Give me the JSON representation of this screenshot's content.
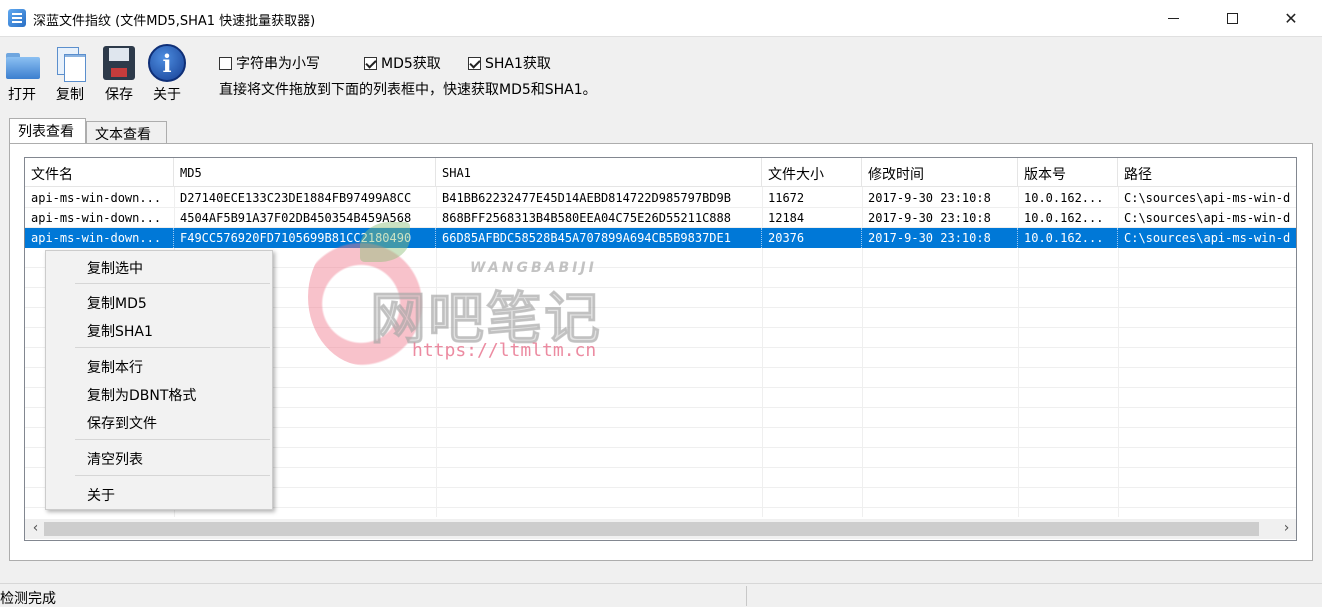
{
  "window": {
    "title": "深蓝文件指纹 (文件MD5,SHA1 快速批量获取器)",
    "min_icon": "minimize-icon",
    "max_icon": "maximize-icon",
    "close_symbol": "✕"
  },
  "toolbar": {
    "open_label": "打开",
    "copy_label": "复制",
    "save_label": "保存",
    "about_label": "关于",
    "info_glyph": "i"
  },
  "options": {
    "lowercase_label": "字符串为小写",
    "lowercase_checked": false,
    "md5_label": "MD5获取",
    "md5_checked": true,
    "sha1_label": "SHA1获取",
    "sha1_checked": true,
    "hint": "直接将文件拖放到下面的列表框中，快速获取MD5和SHA1。"
  },
  "tabs": {
    "list_view": "列表查看",
    "text_view": "文本查看"
  },
  "table": {
    "columns": [
      "文件名",
      "MD5",
      "SHA1",
      "文件大小",
      "修改时间",
      "版本号",
      "路径"
    ],
    "rows": [
      [
        "api-ms-win-down...",
        "D27140ECE133C23DE1884FB97499A8CC",
        "B41BB62232477E45D14AEBD814722D985797BD9B",
        "11672",
        "2017-9-30 23:10:8",
        "10.0.162...",
        "C:\\sources\\api-ms-win-d"
      ],
      [
        "api-ms-win-down...",
        "4504AF5B91A37F02DB450354B459A568",
        "868BFF2568313B4B580EEA04C75E26D55211C888",
        "12184",
        "2017-9-30 23:10:8",
        "10.0.162...",
        "C:\\sources\\api-ms-win-d"
      ],
      [
        "api-ms-win-down...",
        "F49CC576920FD7105699B81CC2180490",
        "66D85AFBDC58528B45A707899A694CB5B9837DE1",
        "20376",
        "2017-9-30 23:10:8",
        "10.0.162...",
        "C:\\sources\\api-ms-win-d"
      ]
    ],
    "selected_row": 2,
    "scroll_left": "‹",
    "scroll_right": "›"
  },
  "context_menu": {
    "copy_selected": "复制选中",
    "copy_md5": "复制MD5",
    "copy_sha1": "复制SHA1",
    "copy_row": "复制本行",
    "copy_dbnt": "复制为DBNT格式",
    "save_to_file": "保存到文件",
    "clear_list": "清空列表",
    "about": "关于"
  },
  "watermark": {
    "english": "WANGBABIJI",
    "chinese": "网吧笔记",
    "url": "https://ltmltm.cn"
  },
  "status": {
    "text": "检测完成"
  },
  "colors": {
    "selection": "#0078d7",
    "window_bg": "#f0f0f0"
  }
}
